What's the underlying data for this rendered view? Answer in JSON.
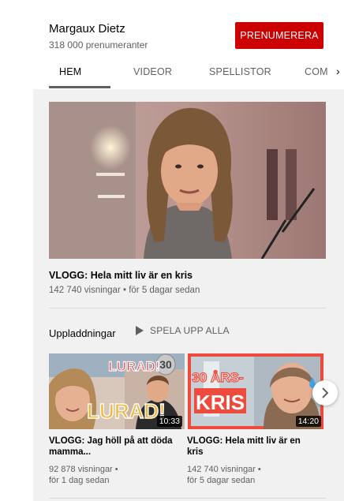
{
  "channel": {
    "name": "Margaux Dietz",
    "subscribers": "318 000 prenumeranter",
    "subscribe_label": "PRENUMERERA",
    "accent_color": "#cc0000"
  },
  "tabs": [
    {
      "label": "HEM",
      "active": true
    },
    {
      "label": "VIDEOR",
      "active": false
    },
    {
      "label": "SPELLISTOR",
      "active": false
    },
    {
      "label": "COM",
      "active": false
    }
  ],
  "featured": {
    "title": "VLOGG: Hela mitt liv är en kris",
    "meta": "142 740 visningar • för 5 dagar sedan"
  },
  "uploads": {
    "title": "Uppladdningar",
    "play_all": "SPELA UPP ALLA",
    "videos": [
      {
        "title_line1": "VLOGG: Jag höll på att döda",
        "title_line2": "mamma...",
        "views": "92 878 visningar •",
        "age": "för 1 dag sedan",
        "duration": "10:33",
        "thumb_text_1": "LURAD!",
        "thumb_text_2": "LURAD!",
        "thumb_balloon": "30"
      },
      {
        "title_line1": "VLOGG: Hela mitt liv är en",
        "title_line2": "kris",
        "views": "142 740 visningar •",
        "age": "för 5 dagar sedan",
        "duration": "14:20",
        "thumb_text_1": "30 ÅRS-",
        "thumb_text_2": "KRIS"
      }
    ]
  }
}
